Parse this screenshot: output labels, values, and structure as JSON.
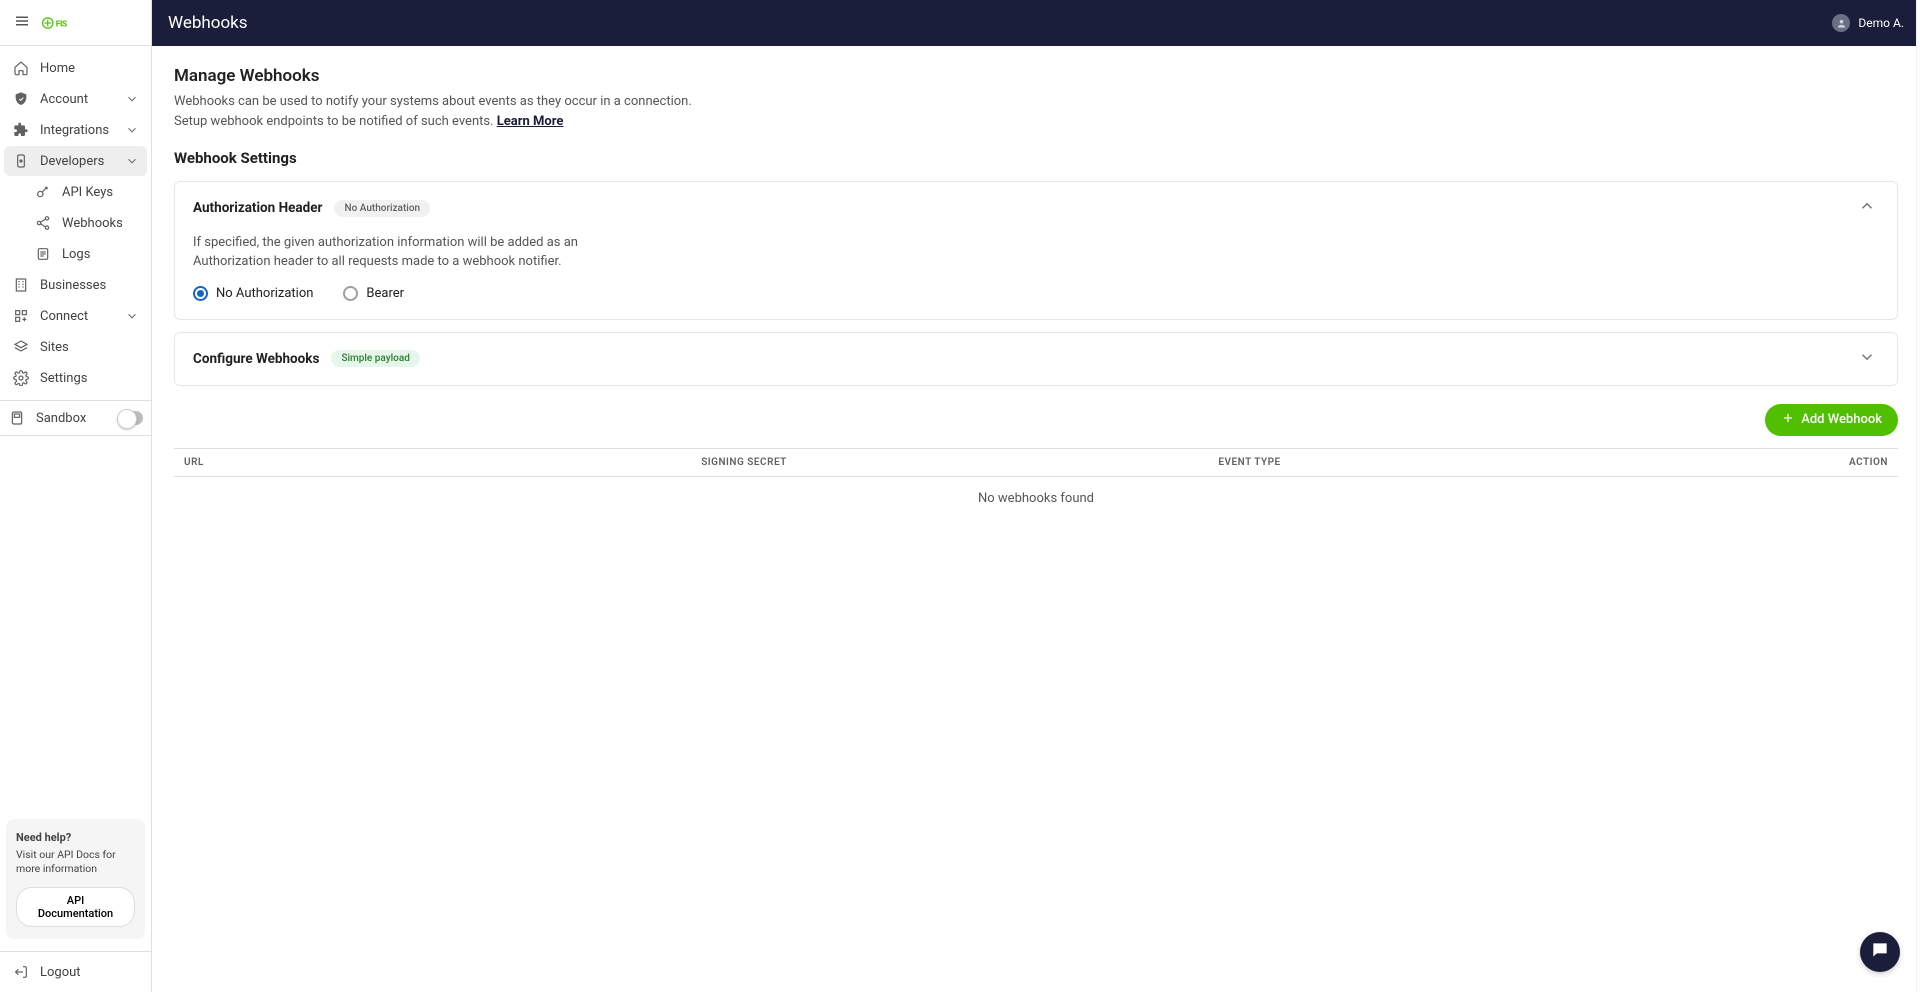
{
  "header": {
    "title": "Webhooks",
    "user_name": "Demo A."
  },
  "sidebar": {
    "items": [
      {
        "label": "Home"
      },
      {
        "label": "Account"
      },
      {
        "label": "Integrations"
      },
      {
        "label": "Developers"
      },
      {
        "label": "Businesses"
      },
      {
        "label": "Connect"
      },
      {
        "label": "Sites"
      },
      {
        "label": "Settings"
      }
    ],
    "developer_sub": [
      {
        "label": "API Keys"
      },
      {
        "label": "Webhooks"
      },
      {
        "label": "Logs"
      }
    ],
    "sandbox_label": "Sandbox",
    "help": {
      "title": "Need help?",
      "body": "Visit our API Docs for more information",
      "cta": "API Documentation"
    },
    "logout_label": "Logout"
  },
  "page": {
    "heading": "Manage Webhooks",
    "desc_line1": "Webhooks can be used to notify your systems about events as they occur in a connection.",
    "desc_line2_prefix": "Setup webhook endpoints to be notified of such events. ",
    "learn_more": "Learn More",
    "settings_heading": "Webhook Settings"
  },
  "auth_card": {
    "title": "Authorization Header",
    "chip": "No Authorization",
    "desc": "If specified, the given authorization information will be added as an Authorization header to all requests made to a webhook notifier.",
    "radio_no_auth": "No Authorization",
    "radio_bearer": "Bearer"
  },
  "config_card": {
    "title": "Configure Webhooks",
    "chip": "Simple payload"
  },
  "add_webhook_label": "Add Webhook",
  "table": {
    "col_url": "URL",
    "col_secret": "Signing Secret",
    "col_event": "Event Type",
    "col_action": "Action",
    "empty": "No webhooks found"
  }
}
